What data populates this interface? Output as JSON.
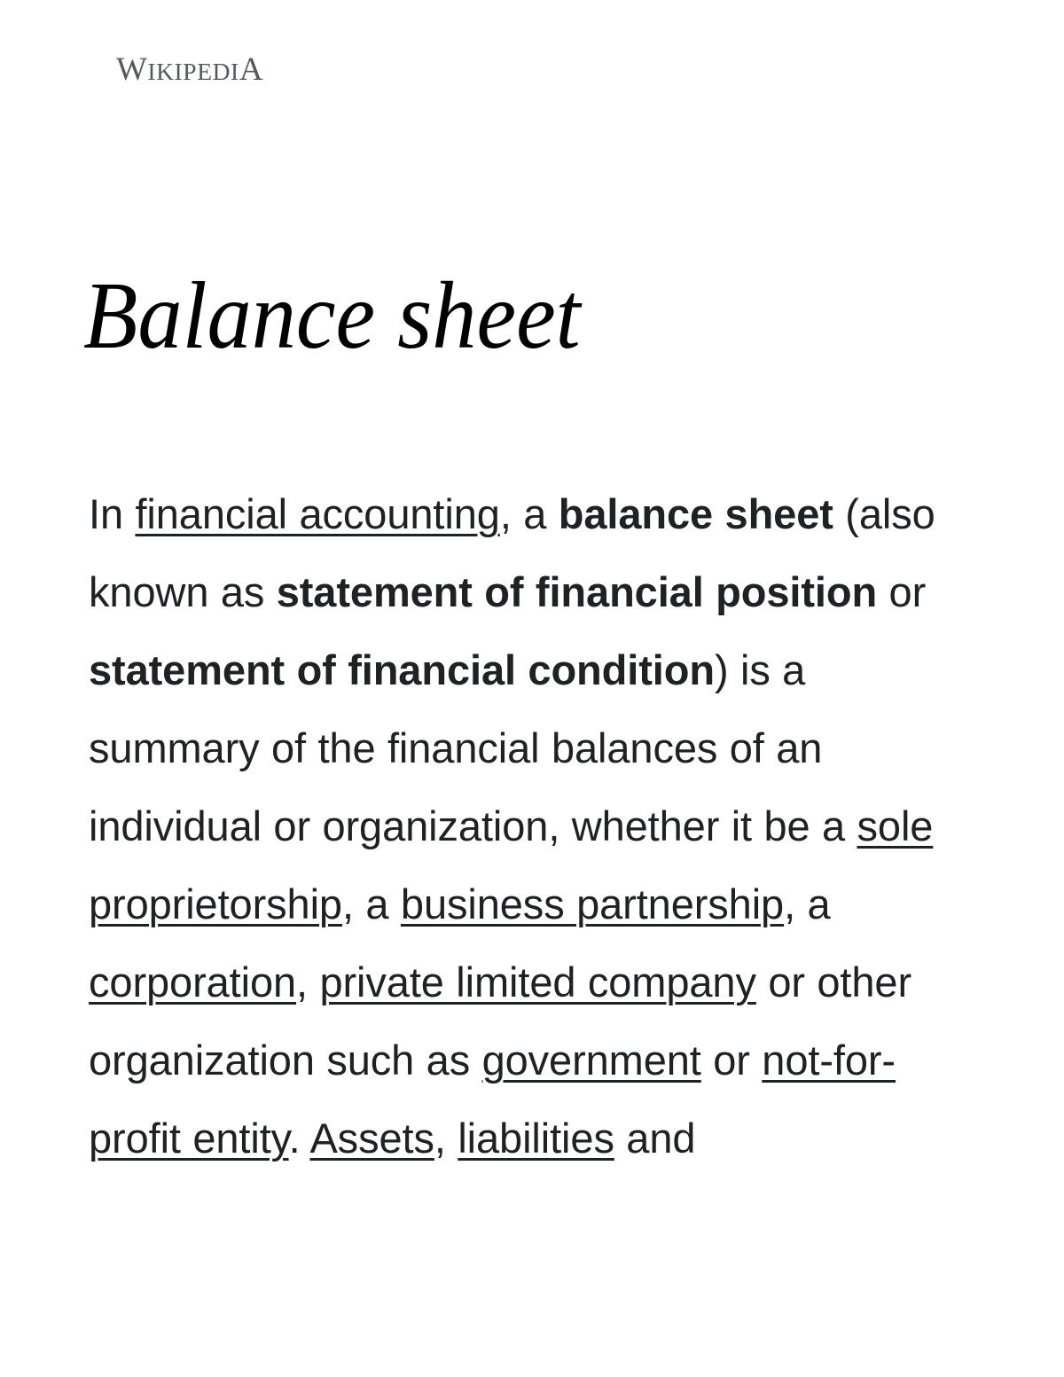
{
  "site": {
    "wordmark": "WIKIPEDIA",
    "wordmark_first_letter": "W",
    "wordmark_middle": "IKIPEDI",
    "wordmark_last_letter": "A",
    "wordmark_color": "#54595d"
  },
  "article": {
    "title": "Balance sheet",
    "title_color": "#000000",
    "body_text_color": "#202122",
    "background_color": "#ffffff",
    "lead": {
      "segments": [
        {
          "type": "text",
          "text": "In "
        },
        {
          "type": "link",
          "text": "financial accounting"
        },
        {
          "type": "text",
          "text": ", a "
        },
        {
          "type": "bold",
          "text": "balance sheet"
        },
        {
          "type": "text",
          "text": " (also known as "
        },
        {
          "type": "bold",
          "text": "statement of financial position"
        },
        {
          "type": "text",
          "text": " or "
        },
        {
          "type": "bold",
          "text": "statement of financial condition"
        },
        {
          "type": "text",
          "text": ") is a summary of the financial balances of an individual or organization, whether it be a "
        },
        {
          "type": "link",
          "text": "sole proprietorship"
        },
        {
          "type": "text",
          "text": ", a "
        },
        {
          "type": "link",
          "text": "business partnership"
        },
        {
          "type": "text",
          "text": ", a "
        },
        {
          "type": "link",
          "text": "corporation"
        },
        {
          "type": "text",
          "text": ", "
        },
        {
          "type": "link",
          "text": "private limited company"
        },
        {
          "type": "text",
          "text": " or other organization such as "
        },
        {
          "type": "link",
          "text": "government"
        },
        {
          "type": "text",
          "text": " or "
        },
        {
          "type": "link",
          "text": "not-for-profit entity"
        },
        {
          "type": "text",
          "text": ". "
        },
        {
          "type": "link",
          "text": "Assets"
        },
        {
          "type": "text",
          "text": ", "
        },
        {
          "type": "link",
          "text": "liabilities"
        },
        {
          "type": "text",
          "text": " and"
        }
      ]
    }
  }
}
